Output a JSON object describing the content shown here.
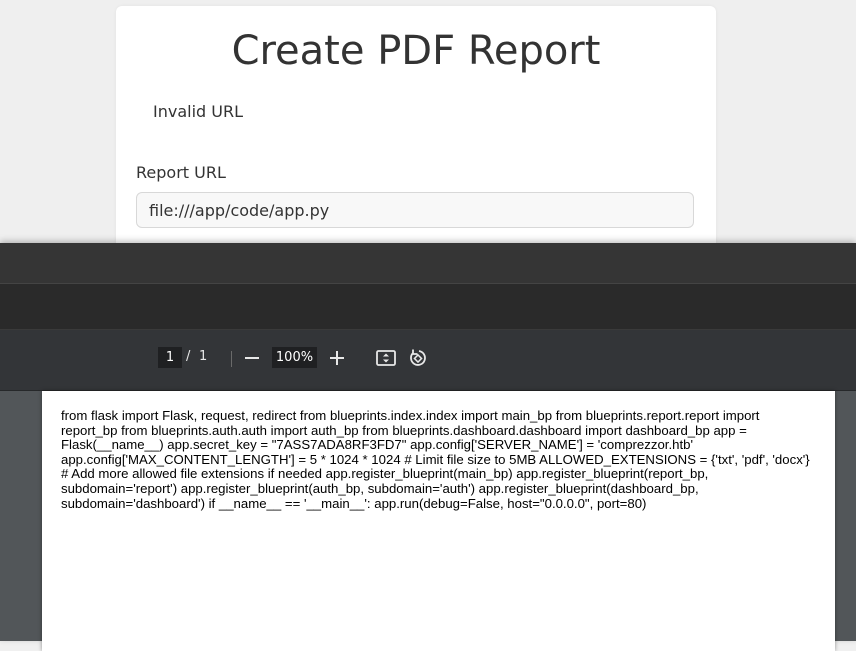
{
  "page": {
    "title": "Create PDF Report",
    "alert": "Invalid URL",
    "report_url_label": "Report URL",
    "report_url_value": "file:///app/code/app.py"
  },
  "viewer": {
    "current_page": "1",
    "page_separator": "/",
    "total_pages": "1",
    "zoom": "100%",
    "icons": [
      "minus-icon",
      "plus-icon",
      "fit-page-icon",
      "rotate-icon"
    ],
    "document_text": "from flask import Flask, request, redirect from blueprints.index.index import main_bp from blueprints.report.report import report_bp from blueprints.auth.auth import auth_bp from blueprints.dashboard.dashboard import dashboard_bp app = Flask(__name__) app.secret_key = \"7ASS7ADA8RF3FD7\" app.config['SERVER_NAME'] = 'comprezzor.htb' app.config['MAX_CONTENT_LENGTH'] = 5 * 1024 * 1024 # Limit file size to 5MB ALLOWED_EXTENSIONS = {'txt', 'pdf', 'docx'} # Add more allowed file extensions if needed app.register_blueprint(main_bp) app.register_blueprint(report_bp, subdomain='report') app.register_blueprint(auth_bp, subdomain='auth') app.register_blueprint(dashboard_bp, subdomain='dashboard') if __name__ == '__main__': app.run(debug=False, host=\"0.0.0.0\", port=80)"
  }
}
